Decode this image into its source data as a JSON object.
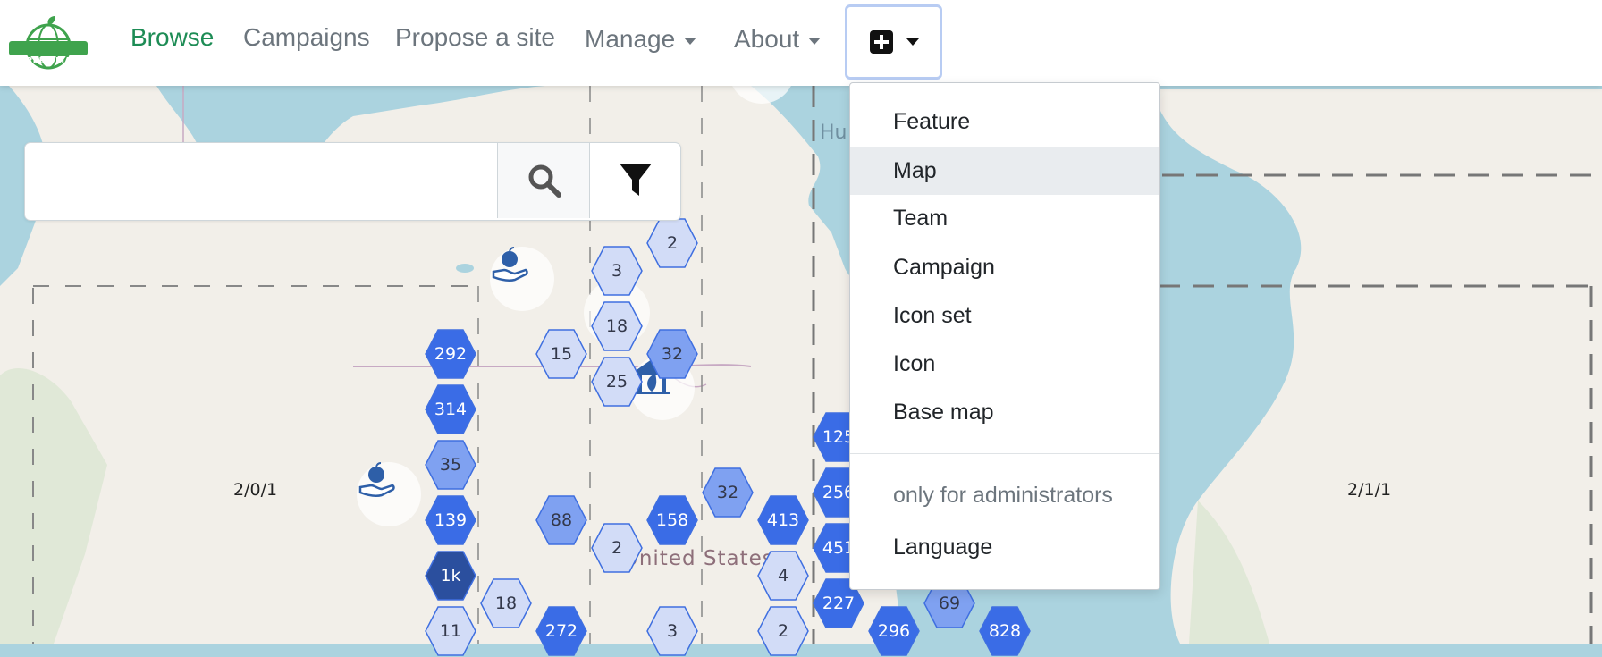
{
  "nav": {
    "logo_text": "GREEN MAP",
    "items": [
      {
        "label": "Browse"
      },
      {
        "label": "Campaigns"
      },
      {
        "label": "Propose a site"
      },
      {
        "label": "Manage"
      },
      {
        "label": "About"
      }
    ],
    "add_icon": "plus-square-icon"
  },
  "search": {
    "value": "",
    "placeholder": "",
    "search_icon": "search-icon",
    "filter_icon": "filter-icon"
  },
  "dropdown": {
    "items": [
      {
        "label": "Feature"
      },
      {
        "label": "Map"
      },
      {
        "label": "Team"
      },
      {
        "label": "Campaign"
      },
      {
        "label": "Icon set"
      },
      {
        "label": "Icon"
      },
      {
        "label": "Base map"
      }
    ],
    "header": "only for administrators",
    "admin_items": [
      {
        "label": "Language"
      }
    ]
  },
  "map": {
    "tile_labels": [
      "2/0/1",
      "2/1/1"
    ],
    "country_label": "United States",
    "water_label_partial": "Hu",
    "clusters": [
      "2",
      "3",
      "18",
      "15",
      "32",
      "25",
      "292",
      "314",
      "35",
      "139",
      "88",
      "158",
      "32",
      "413",
      "2",
      "1k",
      "18",
      "4",
      "11",
      "272",
      "3",
      "2",
      "227",
      "296",
      "69",
      "828",
      "125",
      "256",
      "451"
    ]
  },
  "colors": {
    "brand_green": "#1d8c55",
    "hex_light": "#d2dcf7",
    "hex_mid": "#7fa1f1",
    "hex_dark": "#3a6ce6",
    "hex_darkest": "#2b4f9e",
    "water": "#abd3df",
    "land": "#f2efe9"
  }
}
